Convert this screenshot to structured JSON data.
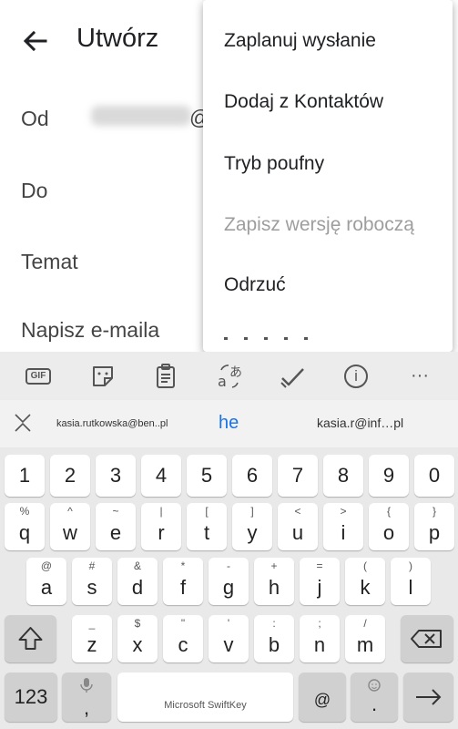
{
  "appbar": {
    "title": "Utwórz"
  },
  "fields": {
    "from_label": "Od",
    "from_value_suffix": "@",
    "to_label": "Do",
    "subject_placeholder": "Temat",
    "body_placeholder": "Napisz e-maila"
  },
  "menu": {
    "items": [
      {
        "label": "Zaplanuj wysłanie",
        "enabled": true
      },
      {
        "label": "Dodaj z Kontaktów",
        "enabled": true
      },
      {
        "label": "Tryb poufny",
        "enabled": true
      },
      {
        "label": "Zapisz wersję roboczą",
        "enabled": false
      },
      {
        "label": "Odrzuć",
        "enabled": true
      }
    ]
  },
  "keyboard": {
    "toolbar_icons": [
      "gif-icon",
      "sticker-icon",
      "clipboard-icon",
      "translate-icon",
      "check-icon",
      "info-icon",
      "more-icon"
    ],
    "toolbar_gif_label": "GIF",
    "toolbar_more_label": "···",
    "toolbar_info_label": "i",
    "suggestions": {
      "left": "kasia.rutkowska@ben..pl",
      "center": "he",
      "right": "kasia.r@inf…pl"
    },
    "number_row": [
      "1",
      "2",
      "3",
      "4",
      "5",
      "6",
      "7",
      "8",
      "9",
      "0"
    ],
    "row1": [
      {
        "k": "q",
        "s": "%"
      },
      {
        "k": "w",
        "s": "^"
      },
      {
        "k": "e",
        "s": "~"
      },
      {
        "k": "r",
        "s": "|"
      },
      {
        "k": "t",
        "s": "["
      },
      {
        "k": "y",
        "s": "]"
      },
      {
        "k": "u",
        "s": "<"
      },
      {
        "k": "i",
        "s": ">"
      },
      {
        "k": "o",
        "s": "{"
      },
      {
        "k": "p",
        "s": "}"
      }
    ],
    "row2": [
      {
        "k": "a",
        "s": "@"
      },
      {
        "k": "s",
        "s": "#"
      },
      {
        "k": "d",
        "s": "&"
      },
      {
        "k": "f",
        "s": "*"
      },
      {
        "k": "g",
        "s": "-"
      },
      {
        "k": "h",
        "s": "+"
      },
      {
        "k": "j",
        "s": "="
      },
      {
        "k": "k",
        "s": "("
      },
      {
        "k": "l",
        "s": ")"
      }
    ],
    "row3": [
      {
        "k": "z",
        "s": "_"
      },
      {
        "k": "x",
        "s": "$"
      },
      {
        "k": "c",
        "s": "\""
      },
      {
        "k": "v",
        "s": "'"
      },
      {
        "k": "b",
        "s": ":"
      },
      {
        "k": "n",
        "s": ";"
      },
      {
        "k": "m",
        "s": "/"
      }
    ],
    "symbols_key": "123",
    "space_label": "Microsoft SwiftKey",
    "comma": ",",
    "at_key": "@",
    "period": "."
  },
  "colors": {
    "accent": "#1a73e8",
    "disabled": "#9e9e9e"
  }
}
